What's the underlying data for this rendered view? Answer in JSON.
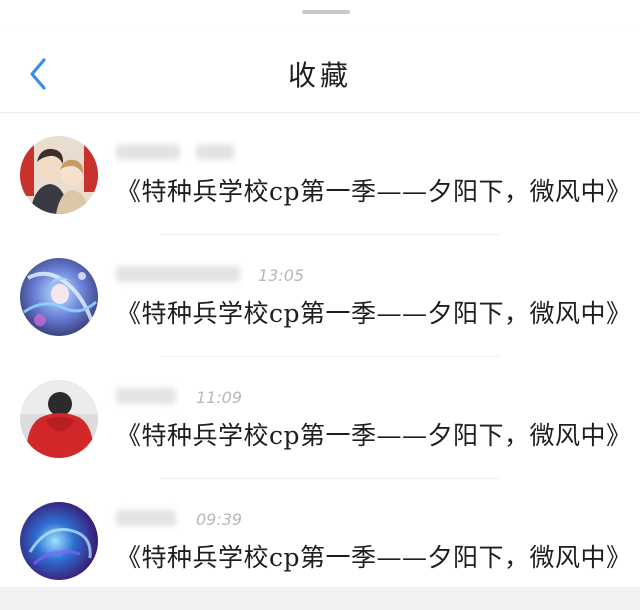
{
  "header": {
    "title": "收藏"
  },
  "favorites": [
    {
      "time": "",
      "title": "《特种兵学校cp第一季——夕阳下，微风中》"
    },
    {
      "time": "13:05",
      "title": "《特种兵学校cp第一季——夕阳下，微风中》"
    },
    {
      "time": "11:09",
      "title": "《特种兵学校cp第一季——夕阳下，微风中》"
    },
    {
      "time": "09:39",
      "title": "《特种兵学校cp第一季——夕阳下，微风中》"
    }
  ],
  "colors": {
    "accent": "#3a8ee6",
    "title_text": "#1e1e1e",
    "time_text": "#b7b7bd"
  }
}
